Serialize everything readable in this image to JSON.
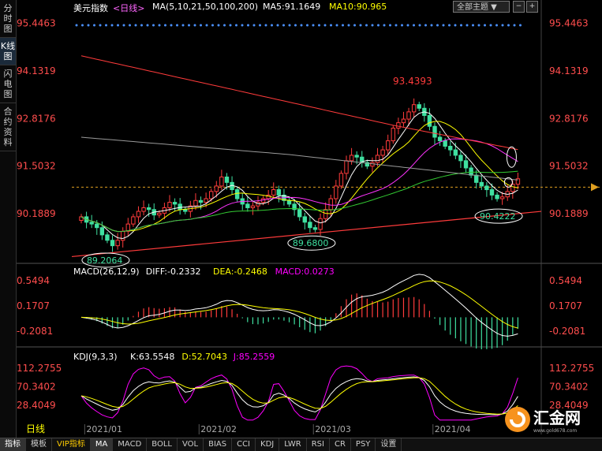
{
  "side_tabs": [
    {
      "label": "分时图",
      "active": false
    },
    {
      "label": "K线图",
      "active": true
    },
    {
      "label": "闪电图",
      "active": false
    },
    {
      "label": "合约资料",
      "active": false
    }
  ],
  "header": {
    "symbol": "美元指数",
    "period": "<日线>",
    "ma_label": "MA(5,10,21,50,100,200)",
    "ma5": "MA5:91.1649",
    "ma10": "MA10:90.965",
    "theme_select": "全部主题",
    "colors": {
      "ma5": "#ffffff",
      "ma10": "#ffff00"
    }
  },
  "main_panel": {
    "y_ticks": [
      "95.4463",
      "94.1319",
      "92.8176",
      "91.5032",
      "90.1889"
    ],
    "ylim": [
      88.9,
      95.7
    ],
    "annotations": {
      "high": "93.4393",
      "low_jan": "89.2064",
      "low_mar": "89.6800",
      "low_apr": "90.4222"
    },
    "current_price_level": 90.92
  },
  "macd_panel": {
    "title": "MACD(26,12,9)",
    "diff": "DIFF:-0.2332",
    "dea": "DEA:-0.2468",
    "macd": "MACD:0.0273",
    "y_ticks": [
      "0.5494",
      "0.1707",
      "-0.2081"
    ],
    "colors": {
      "diff": "#ffffff",
      "dea": "#ffff00",
      "macd": "#ff00ff"
    }
  },
  "kdj_panel": {
    "title": "KDJ(9,3,3)",
    "k": "K:63.5548",
    "d": "D:52.7043",
    "j": "J:85.2559",
    "y_ticks": [
      "112.2755",
      "70.3402",
      "28.4049"
    ],
    "colors": {
      "k": "#ffffff",
      "d": "#ffff00",
      "j": "#ff00ff"
    }
  },
  "x_axis": {
    "period_label": "日线",
    "months": [
      "2021/01",
      "2021/02",
      "2021/03",
      "2021/04"
    ]
  },
  "bottom_tabs": [
    {
      "label": "指标",
      "active": true
    },
    {
      "label": "模板",
      "active": false
    },
    {
      "label": "VIP指标",
      "active": false,
      "vip": true
    },
    {
      "label": "MA",
      "active": true
    },
    {
      "label": "MACD",
      "active": false
    },
    {
      "label": "BOLL",
      "active": false
    },
    {
      "label": "VOL",
      "active": false
    },
    {
      "label": "BIAS",
      "active": false
    },
    {
      "label": "CCI",
      "active": false
    },
    {
      "label": "KDJ",
      "active": false
    },
    {
      "label": "LWR",
      "active": false
    },
    {
      "label": "RSI",
      "active": false
    },
    {
      "label": "CR",
      "active": false
    },
    {
      "label": "PSY",
      "active": false
    },
    {
      "label": "设置",
      "active": false
    }
  ],
  "logo": {
    "name": "汇金网",
    "url": "www.gold678.com"
  },
  "chart_data": {
    "type": "candlestick",
    "title": "美元指数 <日线>",
    "x_labels": [
      "2021/01",
      "2021/02",
      "2021/03",
      "2021/04"
    ],
    "ylim": [
      88.9,
      95.7
    ],
    "closes": [
      90.1,
      89.95,
      89.9,
      89.8,
      89.6,
      89.45,
      89.3,
      89.45,
      89.7,
      89.9,
      90.1,
      90.25,
      90.35,
      90.3,
      90.15,
      90.2,
      90.35,
      90.5,
      90.45,
      90.3,
      90.25,
      90.4,
      90.55,
      90.5,
      90.6,
      90.8,
      90.95,
      91.2,
      91.05,
      90.85,
      90.6,
      90.45,
      90.35,
      90.4,
      90.5,
      90.6,
      90.7,
      90.85,
      90.7,
      90.55,
      90.45,
      90.3,
      90.1,
      89.95,
      89.8,
      89.75,
      90.05,
      90.3,
      90.6,
      90.95,
      91.3,
      91.65,
      91.8,
      91.75,
      91.6,
      91.5,
      91.6,
      91.8,
      91.95,
      92.2,
      92.55,
      92.7,
      92.8,
      93.0,
      93.2,
      93.1,
      92.9,
      92.6,
      92.3,
      92.2,
      92.05,
      91.95,
      91.8,
      91.65,
      91.45,
      91.25,
      91.05,
      90.95,
      90.85,
      90.7,
      90.6,
      90.65,
      90.8,
      91.0,
      91.15
    ]
  }
}
